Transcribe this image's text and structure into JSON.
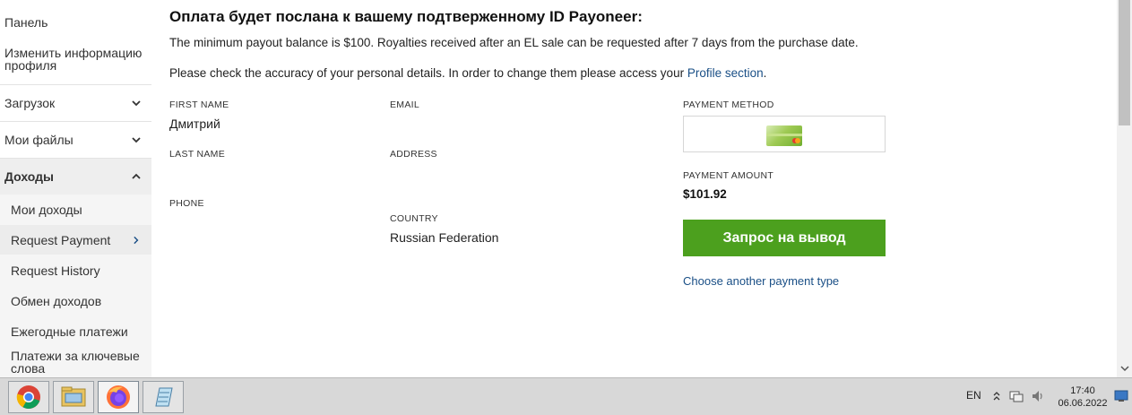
{
  "sidebar": {
    "items": [
      {
        "label": "Панель"
      },
      {
        "label": "Изменить информацию профиля"
      },
      {
        "label": "Загрузок"
      },
      {
        "label": "Мои файлы"
      },
      {
        "label": "Доходы"
      }
    ],
    "subitems": [
      {
        "label": "Мои доходы"
      },
      {
        "label": "Request Payment"
      },
      {
        "label": "Request History"
      },
      {
        "label": "Обмен доходов"
      },
      {
        "label": "Ежегодные платежи"
      },
      {
        "label": "Платежи за ключевые слова"
      }
    ]
  },
  "main": {
    "heading": "Оплата будет послана к вашему подтверженному ID Payoneer:",
    "min_payout": "The minimum payout balance is $100. Royalties received after an EL sale can be requested after 7 days from the purchase date.",
    "check_text": "Please check the accuracy of your personal details. In order to change them please access your ",
    "profile_link": "Profile section",
    "check_end": ".",
    "fields": {
      "first_name_label": "FIRST NAME",
      "first_name_value": "Дмитрий",
      "last_name_label": "LAST NAME",
      "phone_label": "PHONE",
      "email_label": "EMAIL",
      "address_label": "ADDRESS",
      "country_label": "COUNTRY",
      "country_value": "Russian Federation"
    },
    "payment_method_label": "PAYMENT METHOD",
    "payment_amount_label": "PAYMENT AMOUNT",
    "payment_amount": "$101.92",
    "request_button": "Запрос на вывод",
    "alt_link": "Choose another payment type",
    "accent_color": "#4ca01e",
    "link_color": "#1a4f86"
  },
  "taskbar": {
    "apps": [
      {
        "icon": "chrome-icon"
      },
      {
        "icon": "file-explorer-icon"
      },
      {
        "icon": "firefox-icon"
      },
      {
        "icon": "notepad-icon"
      }
    ],
    "lang": "EN",
    "time": "17:40",
    "date": "06.06.2022"
  }
}
